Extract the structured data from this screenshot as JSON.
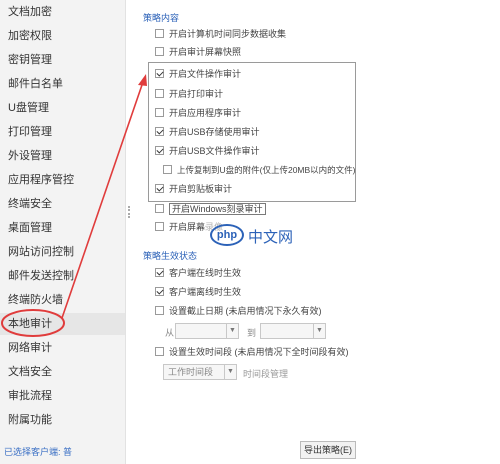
{
  "sidebar": {
    "items": [
      {
        "label": "文档加密"
      },
      {
        "label": "加密权限"
      },
      {
        "label": "密钥管理"
      },
      {
        "label": "邮件白名单"
      },
      {
        "label": "U盘管理"
      },
      {
        "label": "打印管理"
      },
      {
        "label": "外设管理"
      },
      {
        "label": "应用程序管控"
      },
      {
        "label": "终端安全"
      },
      {
        "label": "桌面管理"
      },
      {
        "label": "网站访问控制"
      },
      {
        "label": "邮件发送控制"
      },
      {
        "label": "终端防火墙"
      },
      {
        "label": "本地审计",
        "active": true
      },
      {
        "label": "网络审计"
      },
      {
        "label": "文档安全"
      },
      {
        "label": "审批流程"
      },
      {
        "label": "附属功能"
      }
    ],
    "footer": "已选择客户端: 普"
  },
  "policy_content": {
    "title": "策略内容",
    "options": [
      {
        "label": "开启计算机时间同步数据收集",
        "checked": false
      },
      {
        "label": "开启审计屏幕快照",
        "checked": false
      },
      {
        "label": "开启文件操作审计",
        "checked": true
      },
      {
        "label": "开启打印审计",
        "checked": false
      },
      {
        "label": "开启应用程序审计",
        "checked": false
      },
      {
        "label": "开启USB存储使用审计",
        "checked": true
      },
      {
        "label": "开启USB文件操作审计",
        "checked": true
      },
      {
        "label": "上传复制到U盘的附件(仅上传20MB以内的文件)",
        "checked": false
      },
      {
        "label": "开启剪贴板审计",
        "checked": true
      },
      {
        "label": "开启Windows刻录审计",
        "checked": false
      },
      {
        "label": "开启屏幕录像",
        "checked": false
      }
    ]
  },
  "policy_effect": {
    "title": "策略生效状态",
    "options": [
      {
        "label": "客户端在线时生效",
        "checked": true
      },
      {
        "label": "客户端离线时生效",
        "checked": true
      },
      {
        "label": "设置截止日期 (未启用情况下永久有效)",
        "checked": false
      },
      {
        "label": "设置生效时间段 (未启用情况下全时间段有效)",
        "checked": false
      }
    ],
    "from_label": "从",
    "to_label": "到",
    "weekday_dropdown": "工作时间段",
    "time_manage_label": "时间段管理"
  },
  "buttons": {
    "export": "导出策略(E)"
  },
  "watermark": {
    "logo": "php",
    "text": "中文网"
  },
  "colors": {
    "accent": "#2c62b8",
    "annotation": "#e03c3c"
  }
}
